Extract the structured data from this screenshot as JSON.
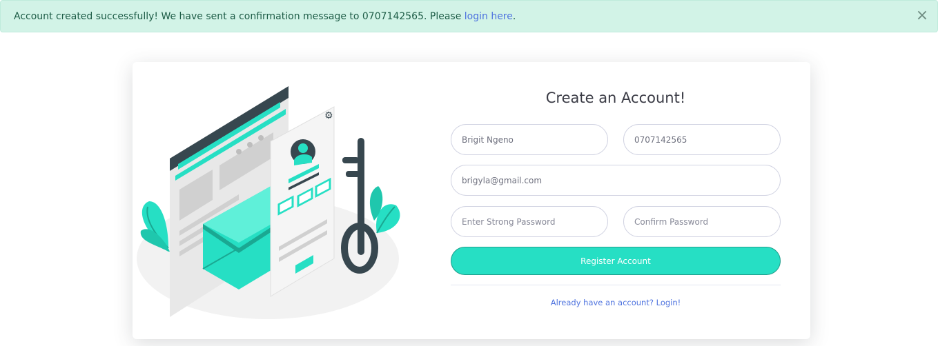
{
  "alert": {
    "message": "Account created successfully! We have sent a confirmation message to 0707142565. Please ",
    "link_text": "login here",
    "suffix": ".",
    "close_symbol": "×"
  },
  "form": {
    "title": "Create an Account!",
    "name_value": "Brigit Ngeno",
    "phone_value": "0707142565",
    "email_value": "brigyla@gmail.com",
    "password_placeholder": "Enter Strong Password",
    "confirm_placeholder": "Confirm Password",
    "submit_label": "Register Account",
    "login_link": "Already have an account? Login!"
  },
  "colors": {
    "accent": "#26dfc4",
    "alert_bg": "#d2f3e7",
    "link": "#4e73df",
    "dark": "#37474f"
  },
  "icons": {
    "close": "close-icon",
    "illustration": "account-security-illustration"
  }
}
